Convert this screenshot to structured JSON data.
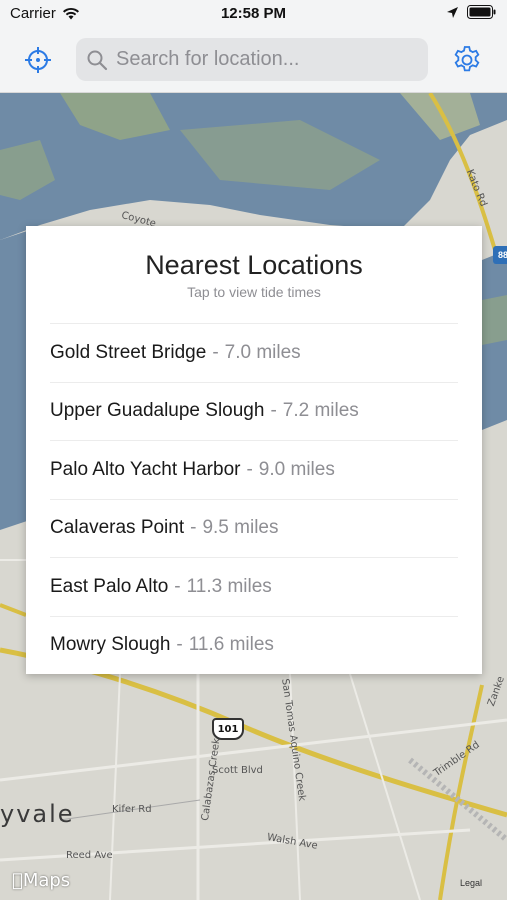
{
  "status_bar": {
    "carrier": "Carrier",
    "time": "12:58 PM"
  },
  "nav": {
    "search_placeholder": "Search for location...",
    "accent_color": "#2c7be5",
    "locate_icon": "crosshair-icon",
    "settings_icon": "gear-icon",
    "search_icon": "search-icon"
  },
  "card": {
    "title": "Nearest Locations",
    "subtitle": "Tap to view tide times",
    "separator": "-",
    "locations": [
      {
        "name": "Gold Street Bridge",
        "distance": "7.0 miles"
      },
      {
        "name": "Upper Guadalupe Slough",
        "distance": "7.2 miles"
      },
      {
        "name": "Palo Alto Yacht Harbor",
        "distance": "9.0 miles"
      },
      {
        "name": "Calaveras Point",
        "distance": "9.5 miles"
      },
      {
        "name": "East Palo Alto",
        "distance": "11.3 miles"
      },
      {
        "name": "Mowry Slough",
        "distance": "11.6 miles"
      }
    ]
  },
  "map": {
    "city_partial": "yvale",
    "highway_101": "101",
    "highway_88": "88",
    "roads": {
      "kato": "Kato Rd",
      "coyote": "Coyote",
      "scott": "Scott Blvd",
      "kifer": "Kifer Rd",
      "reed": "Reed Ave",
      "walsh": "Walsh Ave",
      "calabazas": "Calabazas Creek",
      "san_tomas": "San Tomas Aquino Creek",
      "trimble": "Trimble Rd",
      "zanker": "Zanke",
      "legal": "Legal"
    },
    "logo": "Maps",
    "water_color": "#6f8ba6",
    "land_color": "#d8d7d0"
  }
}
